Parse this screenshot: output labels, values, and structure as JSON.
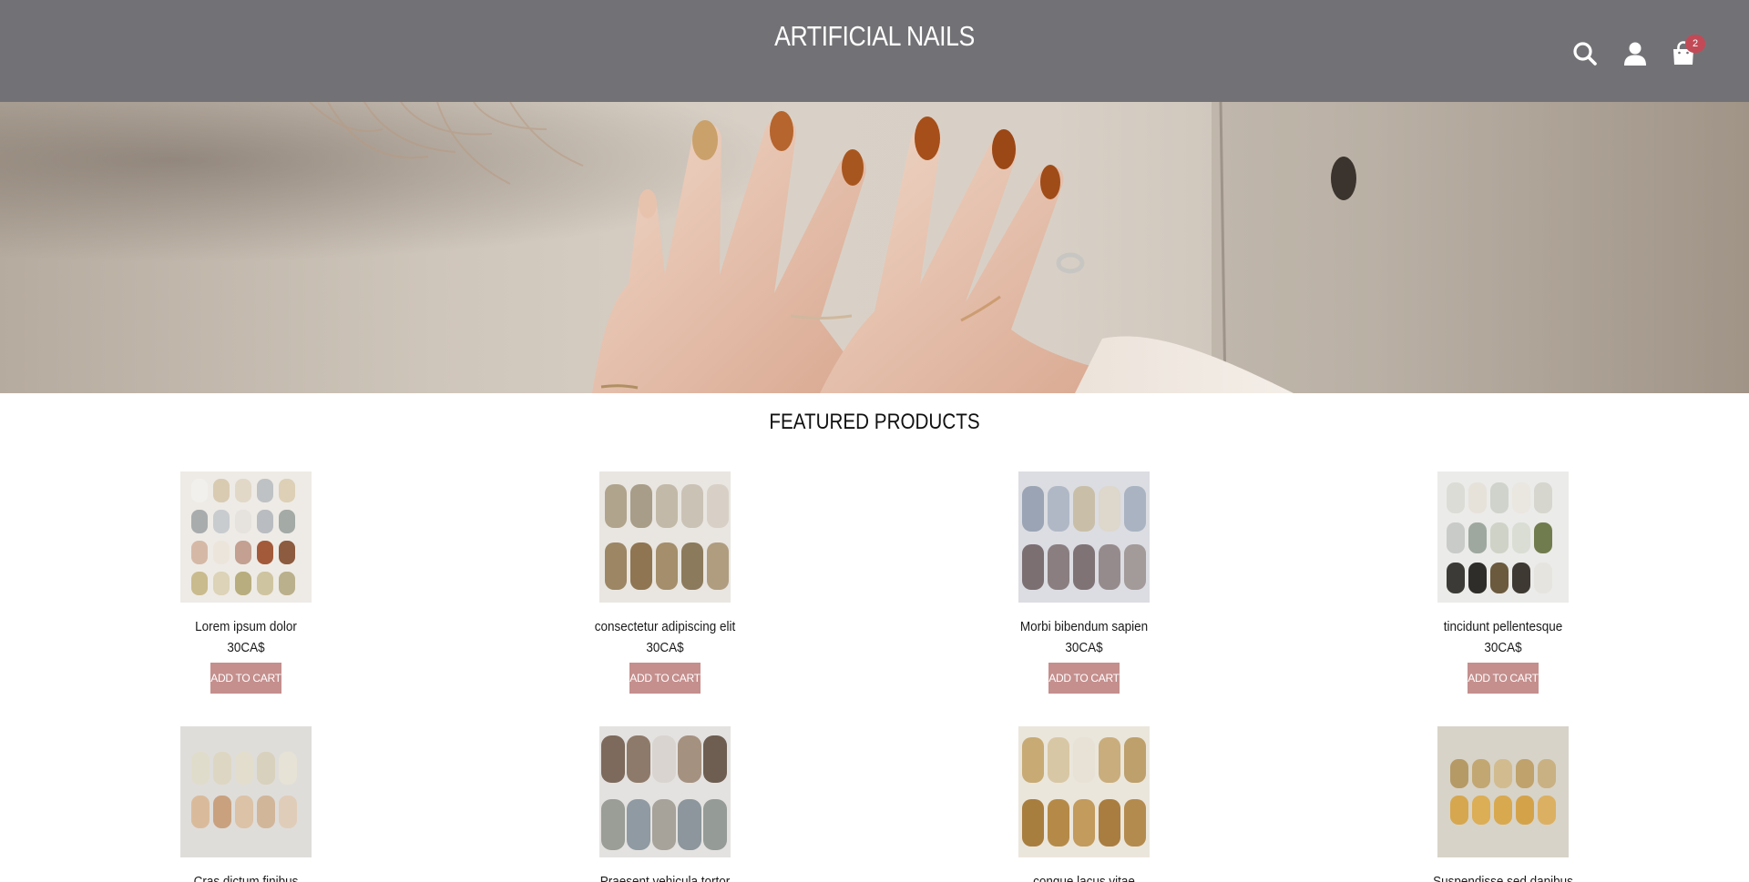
{
  "header": {
    "brand": "ARTIFICIAL NAILS",
    "icons": {
      "search": "search-icon",
      "account": "user-icon",
      "cart": "shopping-bag-icon"
    },
    "cart_count": "2",
    "background": "#727276"
  },
  "hero": {
    "image": "hands-with-manicured-nails-against-wall"
  },
  "featured": {
    "title": "FEATURED PRODUCTS",
    "products": [
      {
        "name": "Lorem ipsum dolor",
        "price": "30CA$",
        "button": "ADD TO CART"
      },
      {
        "name": "consectetur adipiscing elit",
        "price": "30CA$",
        "button": "ADD TO CART"
      },
      {
        "name": "Morbi bibendum sapien",
        "price": "30CA$",
        "button": "ADD TO CART"
      },
      {
        "name": "tincidunt pellentesque",
        "price": "30CA$",
        "button": "ADD TO CART"
      },
      {
        "name": "Cras dictum finibus",
        "price": "",
        "button": ""
      },
      {
        "name": "Praesent vehicula tortor",
        "price": "",
        "button": ""
      },
      {
        "name": "congue lacus vitae",
        "price": "",
        "button": ""
      },
      {
        "name": "Suspendisse sed dapibus",
        "price": "",
        "button": ""
      }
    ]
  },
  "colors": {
    "button": "#c48f8d",
    "badge": "#c24a57",
    "header": "#727276"
  }
}
